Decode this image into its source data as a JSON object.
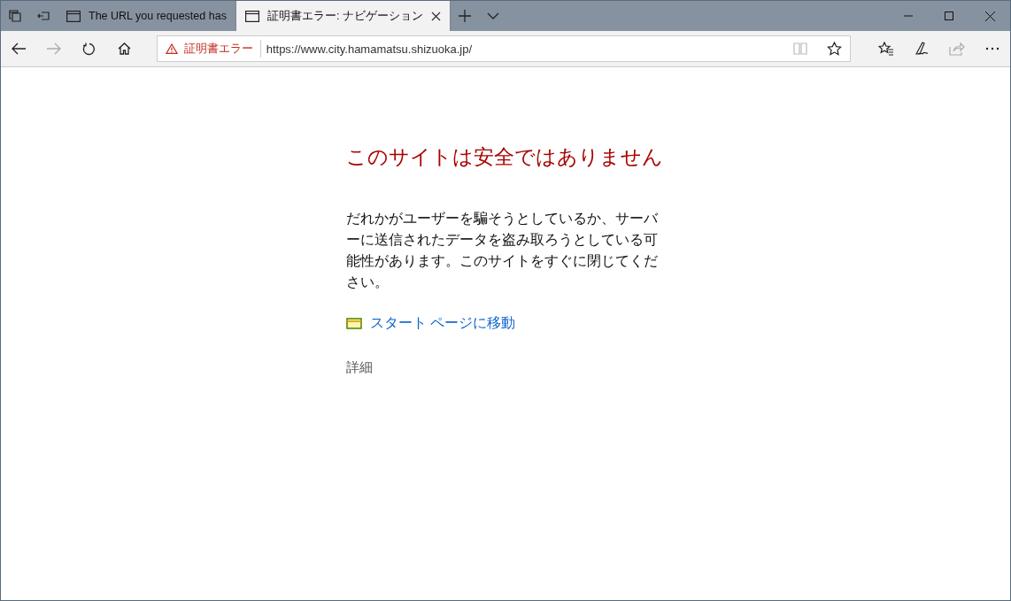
{
  "tabs": [
    {
      "title": "The URL you requested has",
      "selected": false
    },
    {
      "title": "証明書エラー: ナビゲーション",
      "selected": true
    }
  ],
  "toolbar": {
    "back_disabled": false,
    "forward_disabled": true,
    "share_disabled": true,
    "reading_view_disabled": true
  },
  "address_bar": {
    "security_label": "証明書エラー",
    "url": "https://www.city.hamamatsu.shizuoka.jp/"
  },
  "page": {
    "heading": "このサイトは安全ではありません",
    "message": "だれかがユーザーを騙そうとしているか、サーバーに送信されたデータを盗み取ろうとしている可能性があります。このサイトをすぐに閉じてください。",
    "start_page_link": "スタート ページに移動",
    "details_link": "詳細"
  }
}
